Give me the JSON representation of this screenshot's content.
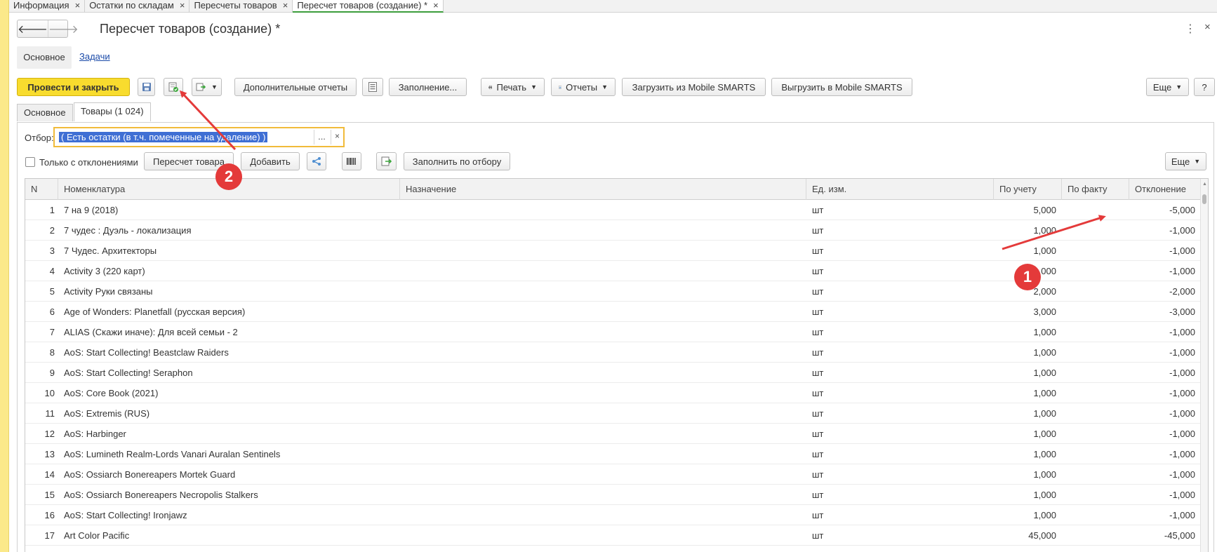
{
  "window_tabs": [
    {
      "label": "Информация",
      "close": "×"
    },
    {
      "label": "Остатки по складам",
      "close": "×"
    },
    {
      "label": "Пересчеты товаров",
      "close": "×"
    },
    {
      "label": "Пересчет товаров (создание) *",
      "close": "×"
    }
  ],
  "header": {
    "back": "🡐",
    "forward": "🡒",
    "title": "Пересчет товаров (создание) *",
    "more": "⋮",
    "close": "×"
  },
  "sections": {
    "main": "Основное",
    "tasks": "Задачи"
  },
  "toolbar": {
    "post_close": "Провести и закрыть",
    "extra_reports": "Дополнительные отчеты",
    "fill": "Заполнение...",
    "print": "Печать",
    "reports": "Отчеты",
    "load_mobile": "Загрузить из Mobile SMARTS",
    "unload_mobile": "Выгрузить в Mobile SMARTS",
    "more": "Еще",
    "help": "?"
  },
  "inner_tabs": {
    "main": "Основное",
    "goods": "Товары (1 024)"
  },
  "filter": {
    "label": "Отбор:",
    "value": "( Есть остатки (в т.ч. помеченные на удаление) )",
    "dots": "...",
    "clear": "×"
  },
  "goods_toolbar": {
    "only_deviations": "Только с отклонениями",
    "recount": "Пересчет товара",
    "add": "Добавить",
    "fill_by_filter": "Заполнить по отбору",
    "more": "Еще"
  },
  "table": {
    "columns": [
      "N",
      "Номенклатура",
      "Назначение",
      "Ед. изм.",
      "По учету",
      "По факту",
      "Отклонение"
    ],
    "rows": [
      {
        "n": "1",
        "name": "7 на 9 (2018)",
        "unit": "шт",
        "acc": "5,000",
        "fact": "",
        "dev": "-5,000"
      },
      {
        "n": "2",
        "name": "7 чудес : Дуэль - локализация",
        "unit": "шт",
        "acc": "1,000",
        "fact": "",
        "dev": "-1,000"
      },
      {
        "n": "3",
        "name": "7 Чудес. Архитекторы",
        "unit": "шт",
        "acc": "1,000",
        "fact": "",
        "dev": "-1,000"
      },
      {
        "n": "4",
        "name": "Activity 3 (220 карт)",
        "unit": "шт",
        "acc": "1,000",
        "fact": "",
        "dev": "-1,000"
      },
      {
        "n": "5",
        "name": "Activity Руки связаны",
        "unit": "шт",
        "acc": "2,000",
        "fact": "",
        "dev": "-2,000"
      },
      {
        "n": "6",
        "name": "Age of Wonders: Planetfall (русская версия)",
        "unit": "шт",
        "acc": "3,000",
        "fact": "",
        "dev": "-3,000"
      },
      {
        "n": "7",
        "name": "ALIAS (Скажи иначе): Для всей семьи - 2",
        "unit": "шт",
        "acc": "1,000",
        "fact": "",
        "dev": "-1,000"
      },
      {
        "n": "8",
        "name": "AoS:  Start Collecting! Beastclaw Raiders",
        "unit": "шт",
        "acc": "1,000",
        "fact": "",
        "dev": "-1,000"
      },
      {
        "n": "9",
        "name": "AoS:  Start Collecting! Seraphon",
        "unit": "шт",
        "acc": "1,000",
        "fact": "",
        "dev": "-1,000"
      },
      {
        "n": "10",
        "name": "AoS: Core Book (2021)",
        "unit": "шт",
        "acc": "1,000",
        "fact": "",
        "dev": "-1,000"
      },
      {
        "n": "11",
        "name": "AoS: Extremis (RUS)",
        "unit": "шт",
        "acc": "1,000",
        "fact": "",
        "dev": "-1,000"
      },
      {
        "n": "12",
        "name": "AoS: Harbinger",
        "unit": "шт",
        "acc": "1,000",
        "fact": "",
        "dev": "-1,000"
      },
      {
        "n": "13",
        "name": "AoS: Lumineth Realm-Lords Vanari Auralan Sentinels",
        "unit": "шт",
        "acc": "1,000",
        "fact": "",
        "dev": "-1,000"
      },
      {
        "n": "14",
        "name": "AoS: Ossiarch Bonereapers Mortek Guard",
        "unit": "шт",
        "acc": "1,000",
        "fact": "",
        "dev": "-1,000"
      },
      {
        "n": "15",
        "name": "AoS: Ossiarch Bonereapers Necropolis Stalkers",
        "unit": "шт",
        "acc": "1,000",
        "fact": "",
        "dev": "-1,000"
      },
      {
        "n": "16",
        "name": "AoS: Start Collecting! Ironjawz",
        "unit": "шт",
        "acc": "1,000",
        "fact": "",
        "dev": "-1,000"
      },
      {
        "n": "17",
        "name": "Art Color Pacific",
        "unit": "шт",
        "acc": "45,000",
        "fact": "",
        "dev": "-45,000"
      }
    ]
  },
  "annotations": {
    "badge1": "1",
    "badge2": "2",
    "color": "#e43a3a"
  }
}
